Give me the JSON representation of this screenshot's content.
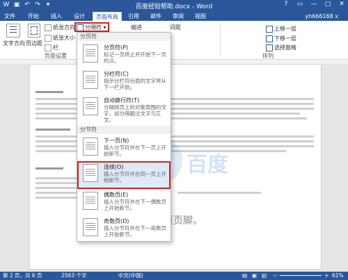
{
  "window": {
    "title": "百度经验帮助.docx - Word",
    "controls": [
      "?",
      "▭",
      "—",
      "□",
      "✕"
    ]
  },
  "quick_access": [
    "save-icon",
    "undo-icon",
    "redo-icon",
    "customize-icon"
  ],
  "tabs": [
    {
      "label": "文件"
    },
    {
      "label": "开始"
    },
    {
      "label": "插入"
    },
    {
      "label": "设计"
    },
    {
      "label": "页面布局"
    },
    {
      "label": "引用"
    },
    {
      "label": "邮件"
    },
    {
      "label": "审阅"
    },
    {
      "label": "视图"
    }
  ],
  "user": "yh666168 x",
  "ribbon": {
    "text_direction": "文字方向",
    "margins": "页边距",
    "orientation": "纸张方向",
    "size": "纸张大小",
    "columns": "栏",
    "breaks": "分隔符",
    "indent": "缩进",
    "spacing": "间距",
    "bring_forward": "上移一层",
    "send_backward": "下移一层",
    "selection_pane": "选择窗格",
    "group_page_setup": "页面设置",
    "group_arrange": "排列"
  },
  "menu": {
    "section_page_breaks": "分页符",
    "section_section_breaks": "分节符",
    "items": [
      {
        "title": "分页符(P)",
        "desc": "标记一页终止并开始下一页的点。"
      },
      {
        "title": "分栏符(C)",
        "desc": "指示分栏符后面的文字将从下一栏开始。"
      },
      {
        "title": "自动换行符(T)",
        "desc": "分隔网页上的对象周围的文字，如分隔题注文字与正文。"
      },
      {
        "title": "下一页(N)",
        "desc": "插入分节符并在下一页上开始新节。"
      },
      {
        "title": "连续(O)",
        "desc": "插入分节符并在同一页上开始新节。"
      },
      {
        "title": "偶数页(E)",
        "desc": "插入分节符并在下一偶数页上开始新节。"
      },
      {
        "title": "奇数页(D)",
        "desc": "插入分节符并在下一奇数页上开始新节。"
      }
    ]
  },
  "document": {
    "footer_heading": "页页脚。"
  },
  "status": {
    "page": "第 2 页，共 6 页",
    "words": "2563 个字",
    "language": "中文(中国)",
    "zoom": "61%"
  },
  "colors": {
    "accent": "#2b579a",
    "highlight": "#d81e1e",
    "selected": "#dfeaf7"
  }
}
